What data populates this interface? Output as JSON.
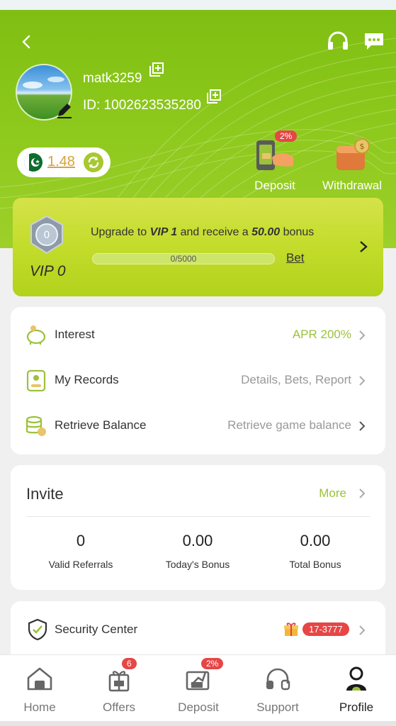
{
  "header": {
    "username": "matk3259",
    "user_id": "ID: 1002623535280",
    "balance": "1.48"
  },
  "quick_actions": [
    {
      "label": "Deposit",
      "badge": "2%"
    },
    {
      "label": "Withdrawal"
    }
  ],
  "vip": {
    "level": "VIP 0",
    "medal_number": "0",
    "upgrade_prefix": "Upgrade to",
    "upgrade_target": "VIP 1",
    "upgrade_middle": "and receive a",
    "upgrade_amount": "50.00",
    "upgrade_suffix": "bonus",
    "progress_label": "0/5000",
    "progress_fraction": 0.0,
    "bet_label": "Bet"
  },
  "menu": [
    {
      "label": "Interest",
      "value": "APR 200%"
    },
    {
      "label": "My Records",
      "value": "Details, Bets, Report"
    },
    {
      "label": "Retrieve Balance",
      "value": "Retrieve game balance"
    }
  ],
  "invite": {
    "title": "Invite",
    "more": "More",
    "stats": [
      {
        "value": "0",
        "label": "Valid Referrals"
      },
      {
        "value": "0.00",
        "label": "Today's Bonus"
      },
      {
        "value": "0.00",
        "label": "Total Bonus"
      }
    ]
  },
  "security": {
    "label": "Security Center",
    "badge": "17-3777"
  },
  "nav": [
    {
      "label": "Home",
      "icon": "home-icon"
    },
    {
      "label": "Offers",
      "icon": "gift-icon",
      "badge": "6"
    },
    {
      "label": "Deposit",
      "icon": "deposit-icon",
      "badge": "2%"
    },
    {
      "label": "Support",
      "icon": "headset-icon"
    },
    {
      "label": "Profile",
      "icon": "profile-icon",
      "active": true
    }
  ],
  "colors": {
    "accent_green": "#8cc81c",
    "vip_card": "#c3dc2b",
    "badge_red": "#e64646",
    "value_green": "#9bc23a",
    "balance_gold": "#d8a23a"
  }
}
